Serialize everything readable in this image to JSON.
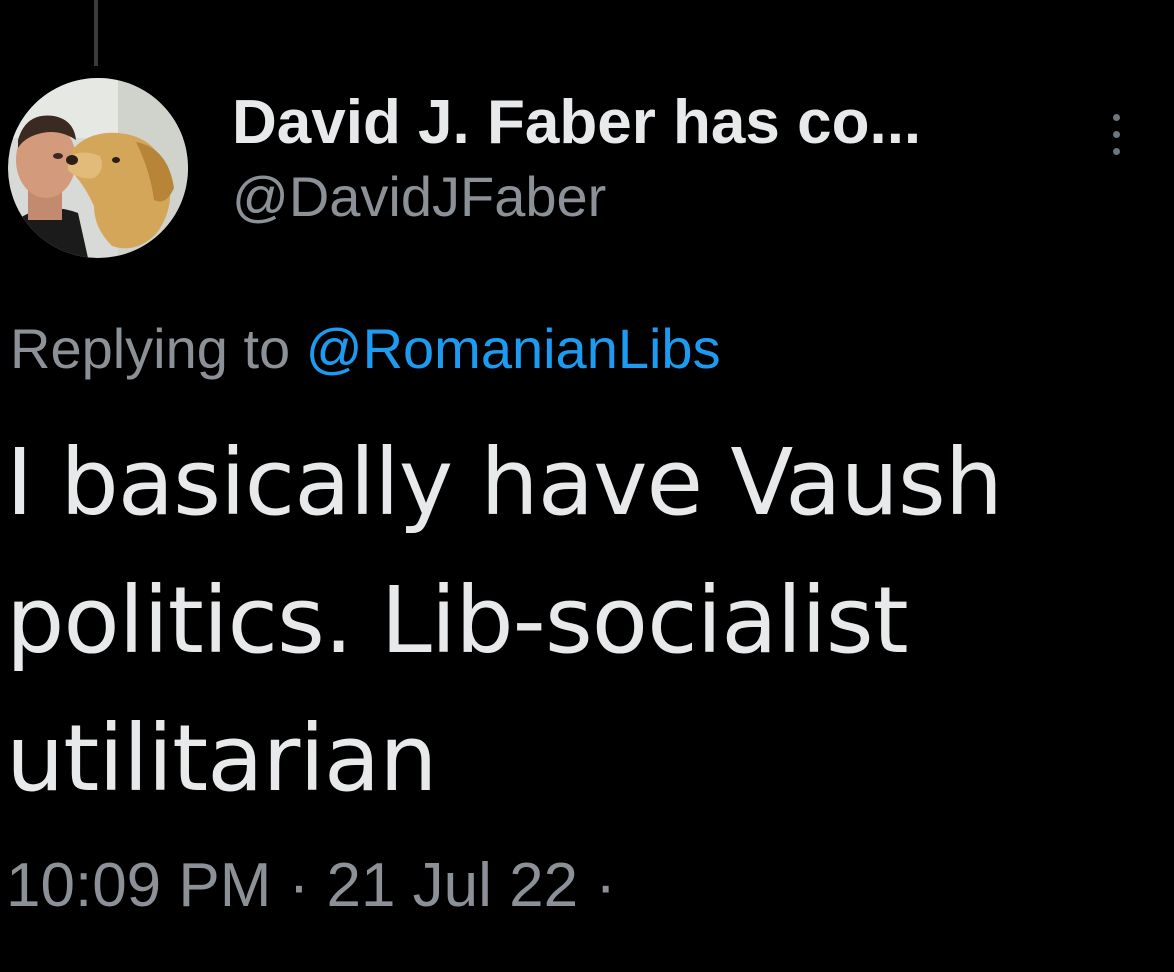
{
  "tweet": {
    "display_name": "David J. Faber has co...",
    "handle": "@DavidJFaber",
    "reply_prefix": "Replying to ",
    "reply_mention": "@RomanianLibs",
    "text_lines": [
      "I basically have Vaush",
      "politics. Lib-socialist",
      "utilitarian"
    ],
    "timestamp": "10:09 PM · 21 Jul 22 ·"
  },
  "icons": {
    "avatar": "profile-photo-man-with-golden-retriever",
    "more": "vertical-ellipsis-icon"
  },
  "colors": {
    "background": "#000000",
    "primary_text": "#e7e9ea",
    "secondary_text": "#8b9196",
    "accent": "#1d9bf0",
    "thread_line": "#3a3d40"
  }
}
